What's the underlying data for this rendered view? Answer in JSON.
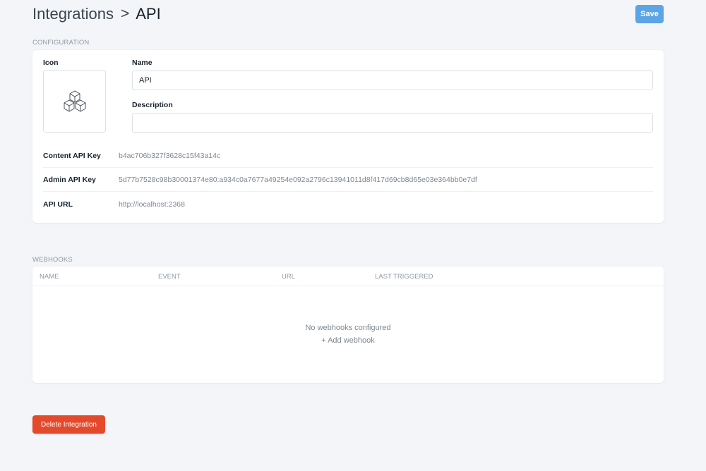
{
  "breadcrumb": {
    "parent": "Integrations",
    "separator": ">",
    "current": "API"
  },
  "header": {
    "save_label": "Save"
  },
  "configuration": {
    "section_label": "CONFIGURATION",
    "icon_label": "Icon",
    "icon_name": "cubes-icon",
    "name_label": "Name",
    "name_value": "API",
    "description_label": "Description",
    "description_value": "",
    "keys": [
      {
        "label": "Content API Key",
        "value": "b4ac706b327f3628c15f43a14c"
      },
      {
        "label": "Admin API Key",
        "value": "5d77b7528c98b30001374e80:a934c0a7677a49254e092a2796c13941011d8f417d69cb8d65e03e364bb0e7df"
      },
      {
        "label": "API URL",
        "value": "http://localhost:2368"
      }
    ]
  },
  "webhooks": {
    "section_label": "WEBHOOKS",
    "columns": [
      "NAME",
      "EVENT",
      "URL",
      "LAST TRIGGERED"
    ],
    "empty_message": "No webhooks configured",
    "add_label": "+ Add webhook"
  },
  "footer": {
    "delete_label": "Delete Integration"
  },
  "colors": {
    "background": "#f4f5f8",
    "save_button": "#5ba4e5",
    "delete_button": "#e4492c"
  }
}
